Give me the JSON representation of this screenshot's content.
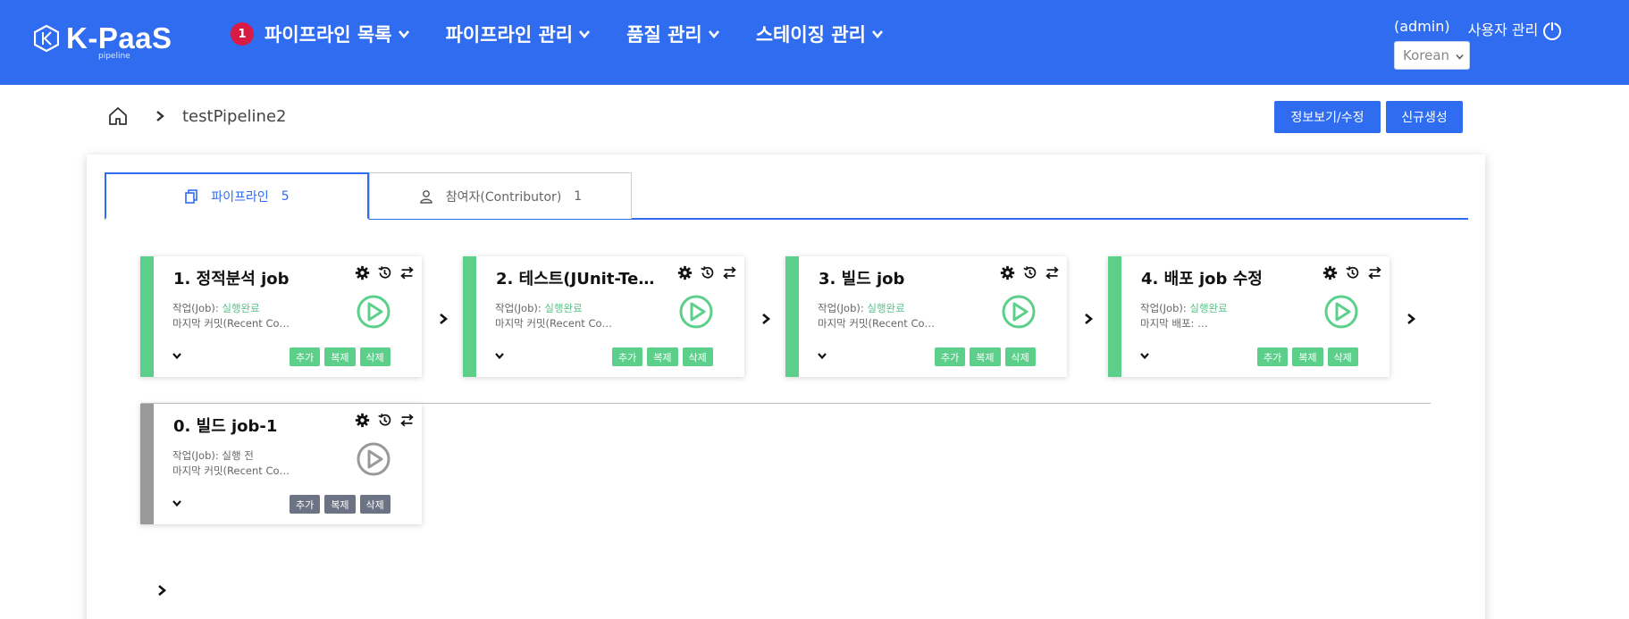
{
  "brand": {
    "name": "K-PaaS",
    "sub": "pipeline"
  },
  "nav": [
    {
      "label": "파이프라인 목록",
      "badge": "1"
    },
    {
      "label": "파이프라인 관리"
    },
    {
      "label": "품질 관리"
    },
    {
      "label": "스테이징 관리"
    }
  ],
  "user": {
    "name": "(admin)",
    "manage": "사용자 관리",
    "language": "Korean"
  },
  "breadcrumb": {
    "title": "testPipeline2"
  },
  "actions": {
    "info": "정보보기/수정",
    "create": "신규생성"
  },
  "tabs": [
    {
      "label": "파이프라인",
      "count": "5"
    },
    {
      "label": "참여자(Contributor)",
      "count": "1"
    }
  ],
  "colors": {
    "primary": "#2f6cf0",
    "success": "#5cd08a",
    "inactive": "#999999",
    "badge": "#d81b45"
  },
  "jobs": [
    {
      "title": "1. 정적분석 job",
      "job_label": "작업(Job): ",
      "status": "실행완료",
      "commit": "마지막 커밋(Recent Co…",
      "state": "done"
    },
    {
      "title": "2. 테스트(JUnit-Te…",
      "job_label": "작업(Job): ",
      "status": "실행완료",
      "commit": "마지막 커밋(Recent Co…",
      "state": "done"
    },
    {
      "title": "3. 빌드 job",
      "job_label": "작업(Job): ",
      "status": "실행완료",
      "commit": "마지막 커밋(Recent Co…",
      "state": "done"
    },
    {
      "title": "4. 배포 job 수정",
      "job_label": "작업(Job): ",
      "status": "실행완료",
      "commit": "마지막 배포: …",
      "state": "done"
    },
    {
      "title": "0. 빌드 job-1",
      "job_label": "작업(Job): ",
      "status": "실행 전",
      "commit": "마지막 커밋(Recent Co…",
      "state": "idle"
    }
  ],
  "card_buttons": {
    "add": "추가",
    "copy": "복제",
    "delete": "삭제"
  }
}
